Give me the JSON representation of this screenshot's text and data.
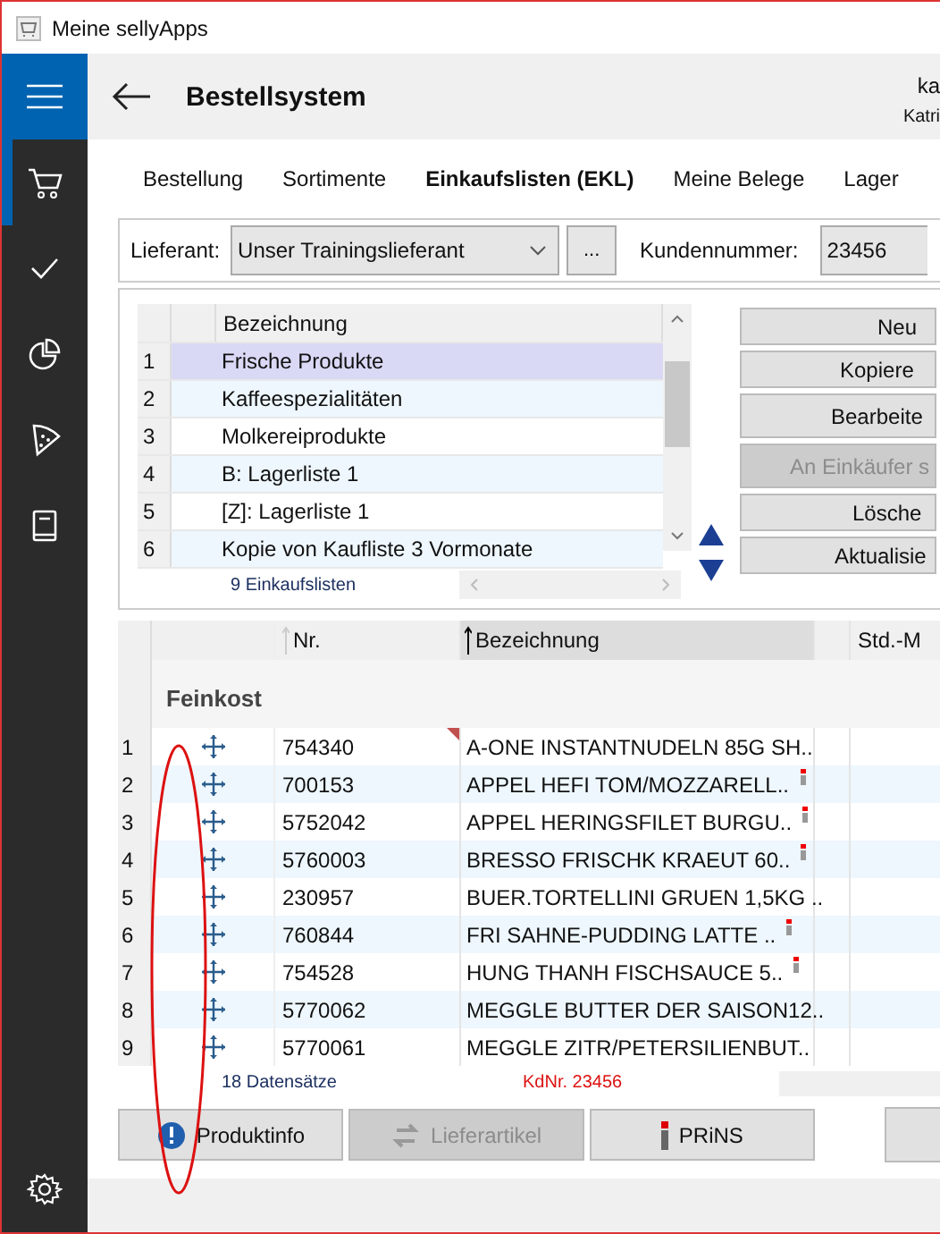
{
  "window": {
    "title": "Meine sellyApps"
  },
  "sidebar": {
    "items": [
      {
        "kind": "cart",
        "selected": true
      },
      {
        "kind": "check",
        "selected": false
      },
      {
        "kind": "pie",
        "selected": false
      },
      {
        "kind": "pizza",
        "selected": false
      },
      {
        "kind": "book",
        "selected": false
      }
    ]
  },
  "header": {
    "title": "Bestellsystem",
    "user_short": "ka",
    "user_name": "Katri"
  },
  "tabs": [
    {
      "label": "Bestellung",
      "selected": false
    },
    {
      "label": "Sortimente",
      "selected": false
    },
    {
      "label": "Einkaufslisten (EKL)",
      "selected": true
    },
    {
      "label": "Meine Belege",
      "selected": false
    },
    {
      "label": "Lager",
      "selected": false
    }
  ],
  "supplier": {
    "label": "Lieferant:",
    "value": "Unser Trainingslieferant",
    "more_button": "...",
    "customer_label": "Kundennummer:",
    "customer_value": "23456"
  },
  "lists": {
    "column": "Bezeichnung",
    "rows": [
      {
        "index": "1",
        "name": "Frische Produkte",
        "selected": true
      },
      {
        "index": "2",
        "name": "Kaffeespezialitäten",
        "selected": false
      },
      {
        "index": "3",
        "name": "Molkereiprodukte",
        "selected": false
      },
      {
        "index": "4",
        "name": "B: Lagerliste 1",
        "selected": false
      },
      {
        "index": "5",
        "name": "[Z]: Lagerliste 1",
        "selected": false
      },
      {
        "index": "6",
        "name": "Kopie von Kaufliste 3 Vormonate",
        "selected": false
      }
    ],
    "count": "9 Einkaufslisten",
    "buttons": [
      {
        "label": "Neu",
        "disabled": false
      },
      {
        "label": "Kopiere",
        "disabled": false
      },
      {
        "label": "Bearbeite",
        "disabled": false
      },
      {
        "label": "An Einkäufer s",
        "disabled": true
      },
      {
        "label": "Lösche",
        "disabled": false
      },
      {
        "label": "Aktualisie",
        "disabled": false
      }
    ]
  },
  "articles": {
    "columns": [
      "Nr.",
      "Bezeichnung",
      "Std.-M"
    ],
    "group": "Feinkost",
    "rows": [
      {
        "index": "1",
        "nr": "754340",
        "name": "A-ONE INSTANTNUDELN 85G SH..",
        "flag": true,
        "info": false
      },
      {
        "index": "2",
        "nr": "700153",
        "name": "APPEL HEFI TOM/MOZZARELL..",
        "flag": false,
        "info": true
      },
      {
        "index": "3",
        "nr": "5752042",
        "name": "APPEL HERINGSFILET BURGU..",
        "flag": false,
        "info": true
      },
      {
        "index": "4",
        "nr": "5760003",
        "name": "BRESSO FRISCHK KRAEUT 60..",
        "flag": false,
        "info": true
      },
      {
        "index": "5",
        "nr": "230957",
        "name": "BUER.TORTELLINI GRUEN 1,5KG ..",
        "flag": false,
        "info": false
      },
      {
        "index": "6",
        "nr": "760844",
        "name": "FRI SAHNE-PUDDING LATTE ..",
        "flag": false,
        "info": true
      },
      {
        "index": "7",
        "nr": "754528",
        "name": "HUNG THANH FISCHSAUCE 5..",
        "flag": false,
        "info": true
      },
      {
        "index": "8",
        "nr": "5770062",
        "name": "MEGGLE BUTTER DER SAISON12..",
        "flag": false,
        "info": false
      },
      {
        "index": "9",
        "nr": "5770061",
        "name": "MEGGLE ZITR/PETERSILIENBUT..",
        "flag": false,
        "info": false
      }
    ],
    "count": "18 Datensätze",
    "customer_note": "KdNr. 23456"
  },
  "buttons": [
    {
      "kind": "info",
      "label": "Produktinfo",
      "disabled": false
    },
    {
      "kind": "swap",
      "label": "Lieferartikel",
      "disabled": true
    },
    {
      "kind": "prins",
      "label": "PRiNS",
      "disabled": false
    }
  ],
  "annotations": [
    {
      "kind": "ellipse"
    }
  ]
}
